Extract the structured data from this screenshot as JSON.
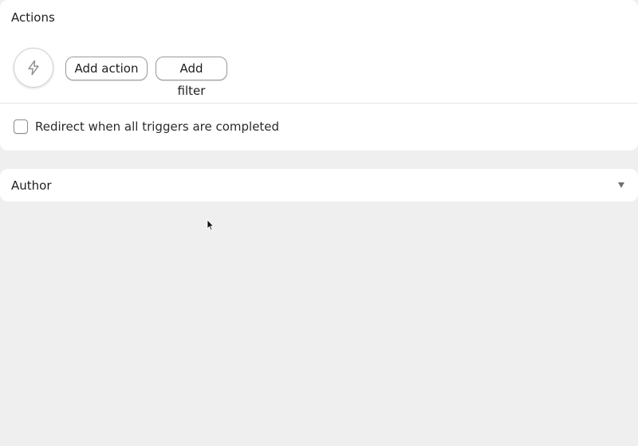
{
  "actions": {
    "title": "Actions",
    "add_action_label": "Add action",
    "add_filter_label": "Add filter",
    "redirect_label": "Redirect when all triggers are completed",
    "redirect_checked": false
  },
  "author": {
    "title": "Author",
    "expanded": false
  },
  "icons": {
    "actions": "lightning-icon",
    "author_toggle": "caret-down-icon"
  }
}
